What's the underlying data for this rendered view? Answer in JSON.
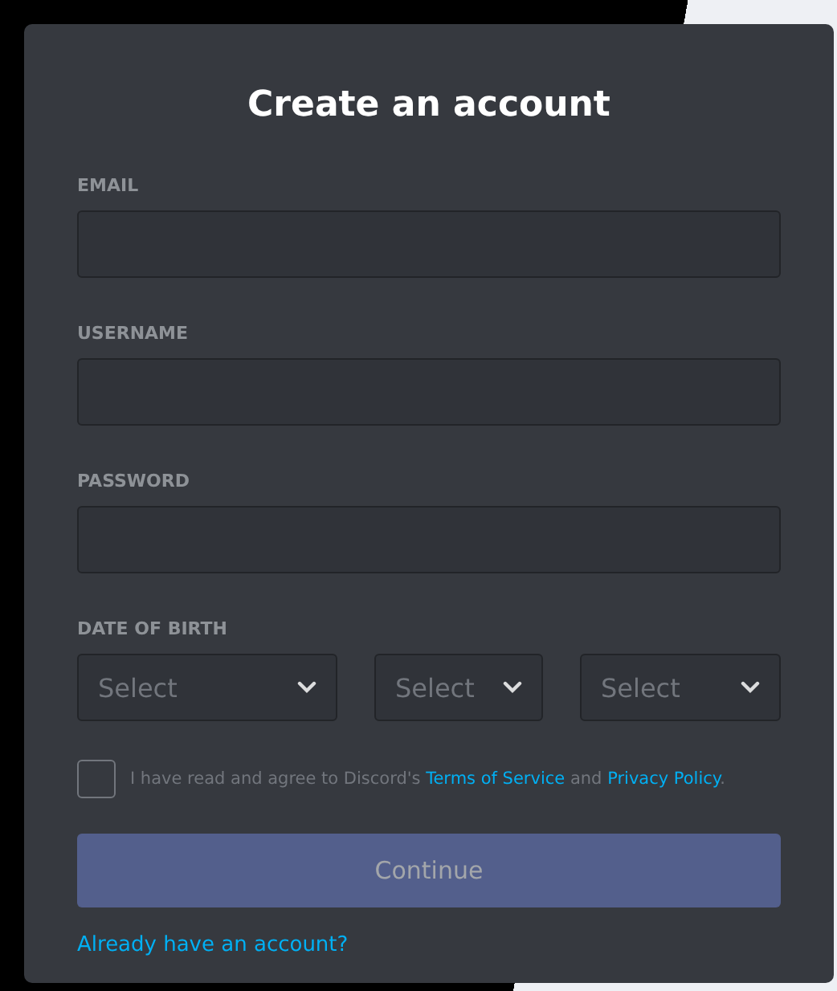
{
  "dialog": {
    "title": "Create an account"
  },
  "fields": [
    {
      "label": "EMAIL"
    },
    {
      "label": "USERNAME"
    },
    {
      "label": "PASSWORD"
    }
  ],
  "date_of_birth": {
    "label": "DATE OF BIRTH",
    "selects": [
      {
        "placeholder": "Select"
      },
      {
        "placeholder": "Select"
      },
      {
        "placeholder": "Select"
      }
    ]
  },
  "agreement": {
    "checked": false,
    "text": "I have read and agree to Discord's",
    "terms_link": "Terms of Service",
    "joiner": "and",
    "privacy_link": "Privacy Policy",
    "end": "."
  },
  "continue_button": {
    "label": "Continue",
    "disabled": true
  },
  "login_link": "Already have an account?"
}
